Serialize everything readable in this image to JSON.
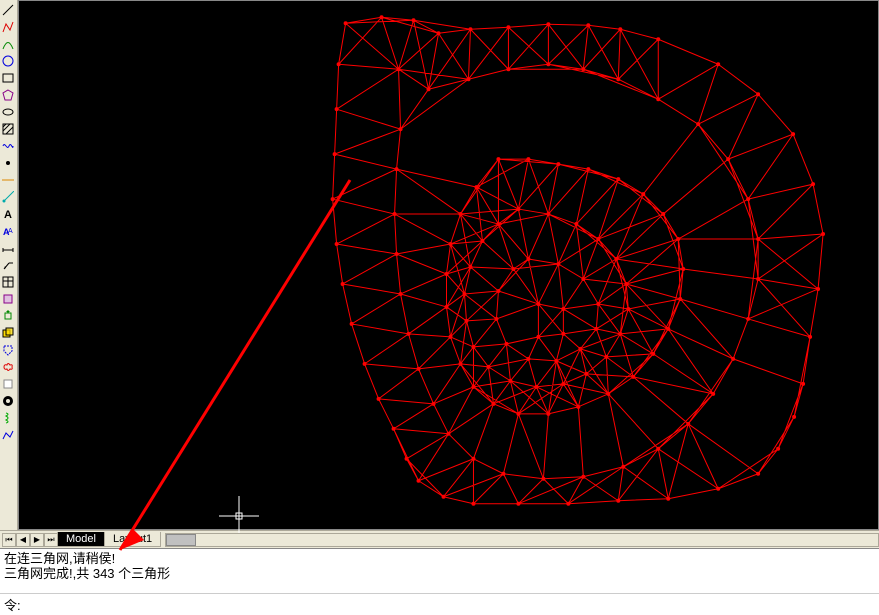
{
  "toolbar": {
    "tools": [
      {
        "name": "line-tool",
        "glyph": "line"
      },
      {
        "name": "polyline-tool",
        "glyph": "polyline"
      },
      {
        "name": "arc-tool",
        "glyph": "arc"
      },
      {
        "name": "circle-tool",
        "glyph": "circle"
      },
      {
        "name": "rectangle-tool",
        "glyph": "rect"
      },
      {
        "name": "polygon-tool",
        "glyph": "polygon"
      },
      {
        "name": "ellipse-tool",
        "glyph": "ellipse"
      },
      {
        "name": "hatch-tool",
        "glyph": "hatch"
      },
      {
        "name": "spline-tool",
        "glyph": "spline"
      },
      {
        "name": "point-tool",
        "glyph": "point"
      },
      {
        "name": "construction-line-tool",
        "glyph": "xline"
      },
      {
        "name": "ray-tool",
        "glyph": "ray"
      },
      {
        "name": "text-tool",
        "glyph": "text"
      },
      {
        "name": "mtext-tool",
        "glyph": "mtext"
      },
      {
        "name": "dimension-tool",
        "glyph": "dim"
      },
      {
        "name": "leader-tool",
        "glyph": "leader"
      },
      {
        "name": "table-tool",
        "glyph": "table"
      },
      {
        "name": "block-tool",
        "glyph": "block"
      },
      {
        "name": "insert-tool",
        "glyph": "insert"
      },
      {
        "name": "region-tool",
        "glyph": "region"
      },
      {
        "name": "boundary-tool",
        "glyph": "boundary"
      },
      {
        "name": "revision-cloud-tool",
        "glyph": "revcloud"
      },
      {
        "name": "wipeout-tool",
        "glyph": "wipeout"
      },
      {
        "name": "donut-tool",
        "glyph": "donut"
      },
      {
        "name": "helix-tool",
        "glyph": "helix"
      },
      {
        "name": "3dpoly-tool",
        "glyph": "3dpoly"
      }
    ]
  },
  "tabs": {
    "model": "Model",
    "layout1": "Layout1"
  },
  "command": {
    "line1": "在连三角网,请稍侯!",
    "line2_prefix": "三角网完成!,共 ",
    "triangle_count": "343",
    "line2_suffix": " 个三角形",
    "prompt": "令: "
  },
  "mesh": {
    "stroke": "#ff0000",
    "node_fill": "#ff0000"
  }
}
